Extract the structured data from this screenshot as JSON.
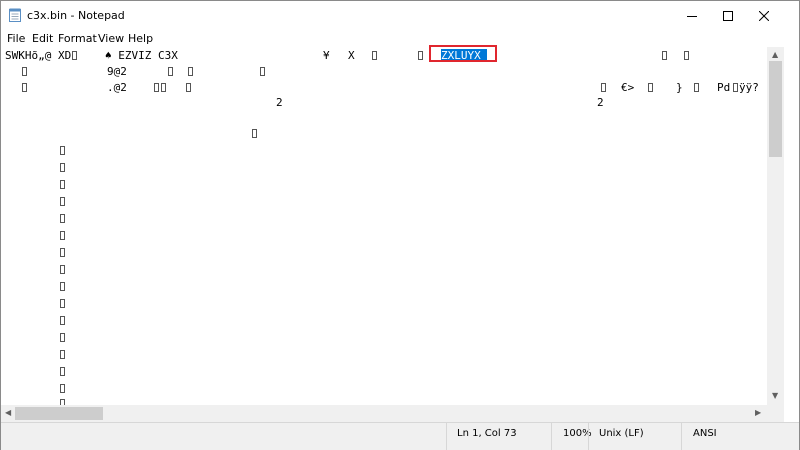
{
  "window": {
    "title": "c3x.bin - Notepad",
    "controls": {
      "minimize": "—",
      "maximize": "☐",
      "close": "✕"
    }
  },
  "menu": {
    "file": "File",
    "edit": "Edit",
    "format": "Format",
    "view": "View",
    "help": "Help"
  },
  "editor": {
    "line1": {
      "a": "SWKHõ„@ XD",
      "b": "♠ EZVIZ C3X",
      "c": "¥",
      "d": "X",
      "selected": "ZXLUYX "
    },
    "line2": {
      "a": "9@2"
    },
    "line3": {
      "a": ".@2",
      "b": "€>",
      "c": "}",
      "d": "Pd",
      "e": "ÿÿ?"
    },
    "line4": {
      "a": "2",
      "b": "2"
    },
    "highlight_color": "#0078d7",
    "annotation_color": "#e0262e"
  },
  "status": {
    "position": "Ln 1, Col 73",
    "zoom": "100%",
    "line_endings": "Unix (LF)",
    "encoding": "ANSI"
  }
}
